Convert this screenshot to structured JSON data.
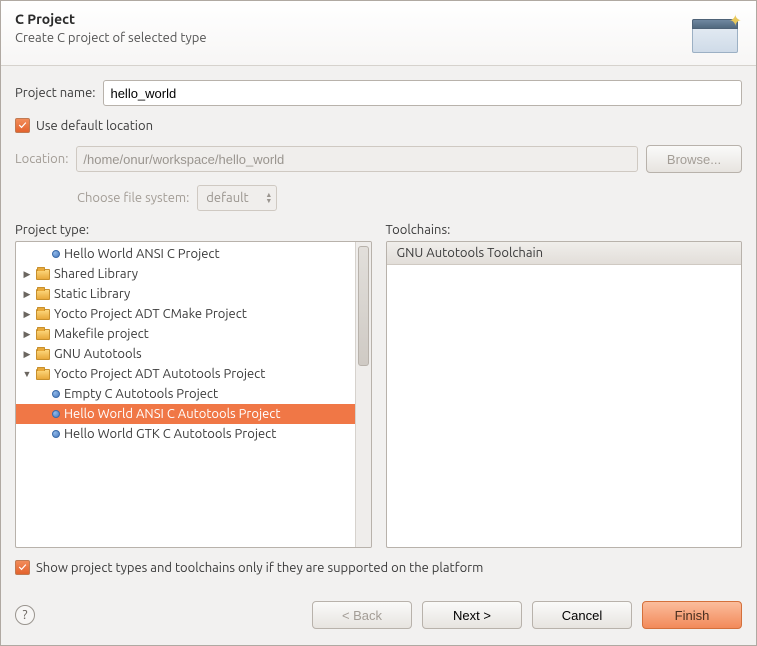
{
  "header": {
    "title": "C Project",
    "subtitle": "Create C project of selected type"
  },
  "project_name": {
    "label": "Project name:",
    "value": "hello_world"
  },
  "use_default_location": {
    "label": "Use default location",
    "checked": true
  },
  "location": {
    "label": "Location:",
    "value": "/home/onur/workspace/hello_world",
    "browse": "Browse..."
  },
  "filesystem": {
    "label": "Choose file system:",
    "value": "default"
  },
  "project_type": {
    "label": "Project type:",
    "items": [
      {
        "level": 1,
        "icon": "dot",
        "expander": "",
        "label": "Hello World ANSI C Project",
        "selected": false
      },
      {
        "level": 0,
        "icon": "folder",
        "expander": "▶",
        "label": "Shared Library",
        "selected": false
      },
      {
        "level": 0,
        "icon": "folder",
        "expander": "▶",
        "label": "Static Library",
        "selected": false
      },
      {
        "level": 0,
        "icon": "folder",
        "expander": "▶",
        "label": "Yocto Project ADT CMake Project",
        "selected": false
      },
      {
        "level": 0,
        "icon": "folder",
        "expander": "▶",
        "label": "Makefile project",
        "selected": false
      },
      {
        "level": 0,
        "icon": "folder",
        "expander": "▶",
        "label": "GNU Autotools",
        "selected": false
      },
      {
        "level": 0,
        "icon": "folder",
        "expander": "▼",
        "label": "Yocto Project ADT Autotools Project",
        "selected": false
      },
      {
        "level": 1,
        "icon": "dot",
        "expander": "",
        "label": "Empty C Autotools Project",
        "selected": false
      },
      {
        "level": 1,
        "icon": "dot",
        "expander": "",
        "label": "Hello World ANSI C Autotools Project",
        "selected": true
      },
      {
        "level": 1,
        "icon": "dot",
        "expander": "",
        "label": "Hello World GTK C Autotools Project",
        "selected": false
      }
    ]
  },
  "toolchains": {
    "label": "Toolchains:",
    "items": [
      {
        "label": "GNU Autotools Toolchain",
        "selected": true
      }
    ]
  },
  "show_supported": {
    "label": "Show project types and toolchains only if they are supported on the platform",
    "checked": true
  },
  "footer": {
    "help": "?",
    "back": "< Back",
    "next": "Next >",
    "cancel": "Cancel",
    "finish": "Finish"
  }
}
